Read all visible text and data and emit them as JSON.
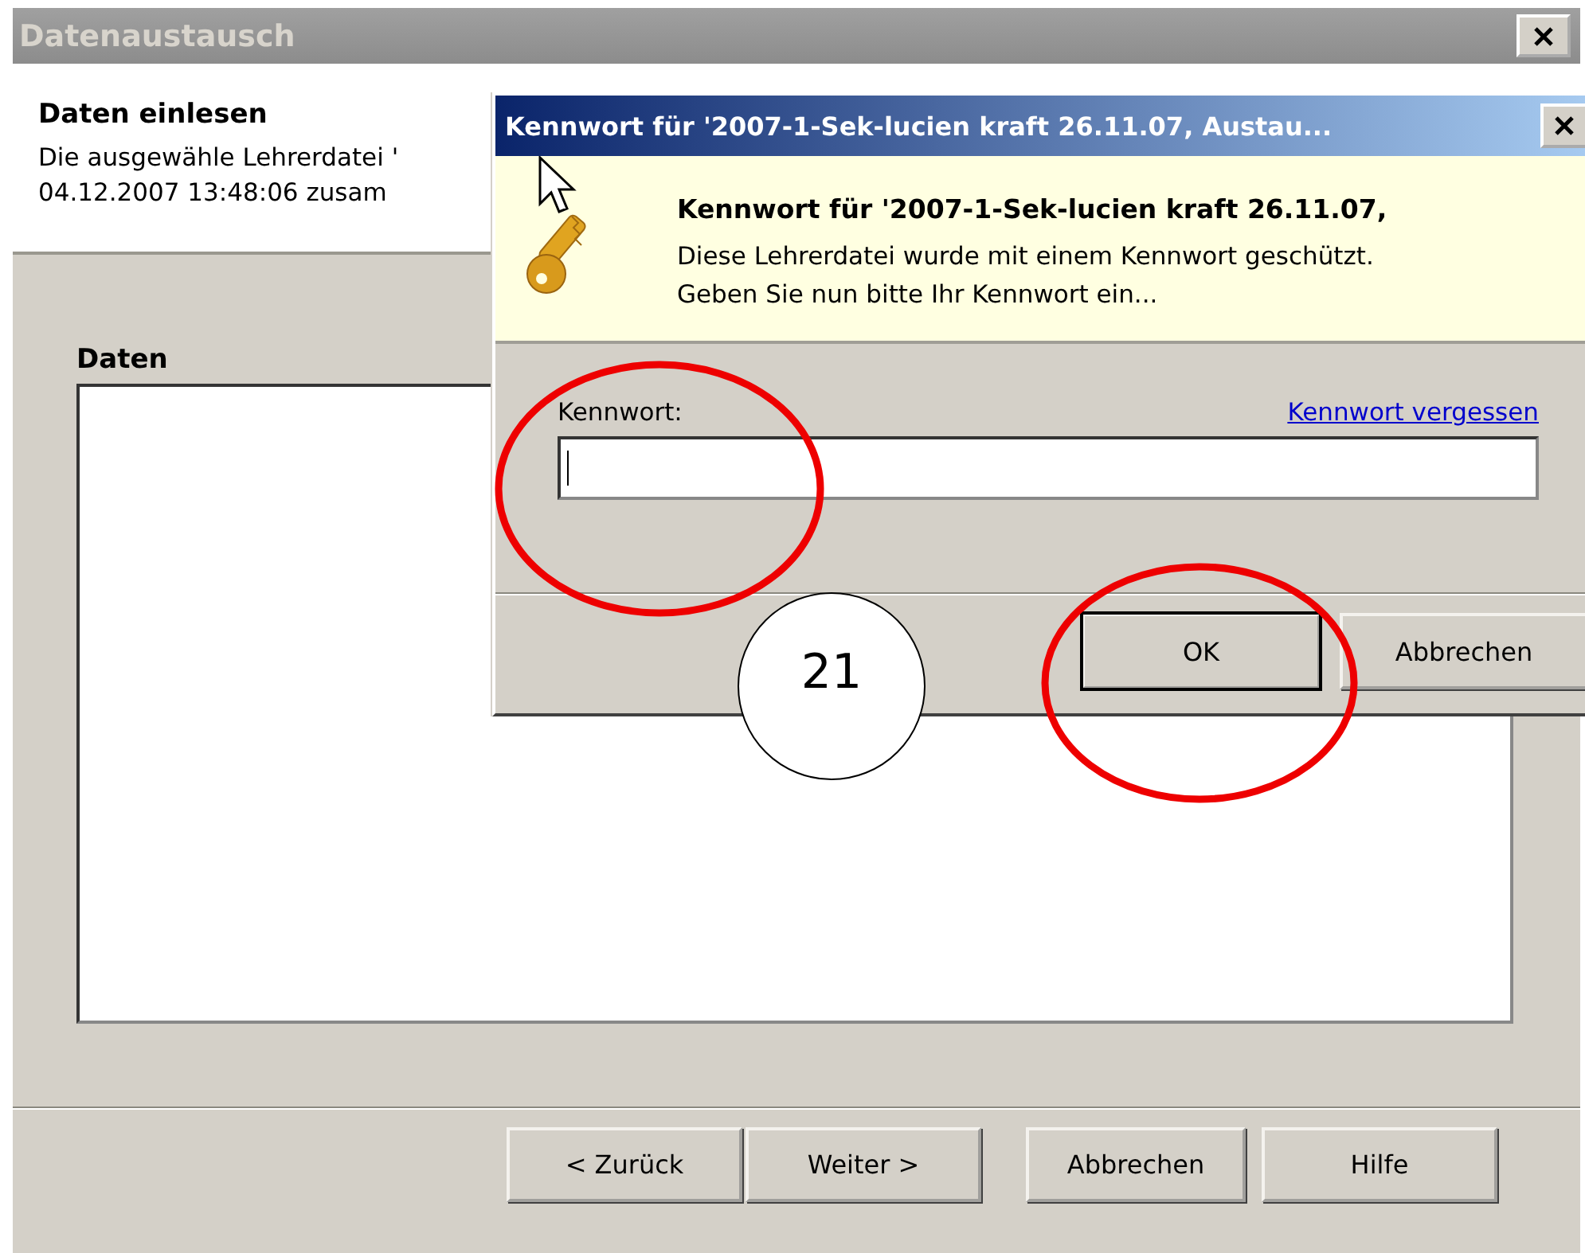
{
  "window": {
    "title": "Datenaustausch"
  },
  "header": {
    "title": "Daten einlesen",
    "description_lines": [
      "Die ausgewähle Lehrerdatei '",
      "04.12.2007 13:48:06 zusam"
    ]
  },
  "data_section": {
    "label": "Daten"
  },
  "buttons": [
    {
      "label": "< Zurück"
    },
    {
      "label": "Weiter >"
    },
    {
      "label": "Abbrechen"
    },
    {
      "label": "Hilfe"
    }
  ],
  "dialog": {
    "title": "Kennwort für '2007-1-Sek-lucien kraft 26.11.07, Austau...",
    "heading": "Kennwort für '2007-1-Sek-lucien kraft 26.11.07,",
    "message_lines": [
      "Diese Lehrerdatei wurde mit einem Kennwort geschützt.",
      "Geben Sie nun bitte Ihr Kennwort ein..."
    ],
    "field_label": "Kennwort:",
    "link": "Kennwort vergessen",
    "field": {
      "focused": true
    },
    "buttons": [
      {
        "label": "OK",
        "default": true
      },
      {
        "label": "Abbrechen",
        "default": false
      }
    ]
  },
  "annotations": [
    {
      "kind": "ellipse"
    },
    {
      "kind": "ellipse"
    },
    {
      "kind": "number",
      "text": "21"
    }
  ]
}
